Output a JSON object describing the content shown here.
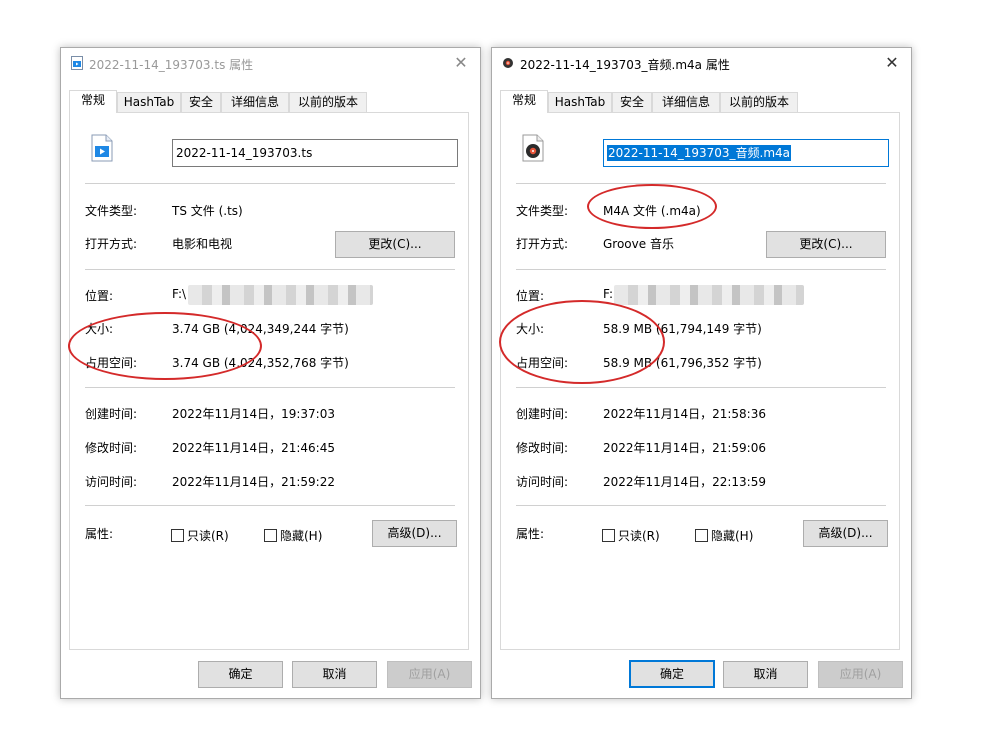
{
  "dialogs": [
    {
      "title": "2022-11-14_193703.ts 属性",
      "tabs": [
        "常规",
        "HashTab",
        "安全",
        "详细信息",
        "以前的版本"
      ],
      "filename": "2022-11-14_193703.ts",
      "type_label": "文件类型:",
      "type_value": "TS 文件 (.ts)",
      "open_label": "打开方式:",
      "open_value": "电影和电视",
      "change_button": "更改(C)...",
      "location_label": "位置:",
      "location_value": "F:\\",
      "size_label": "大小:",
      "size_value": "3.74 GB (4,024,349,244 字节)",
      "disk_label": "占用空间:",
      "disk_value": "3.74 GB (4,024,352,768 字节)",
      "created_label": "创建时间:",
      "created_value": "2022年11月14日，19:37:03",
      "modified_label": "修改时间:",
      "modified_value": "2022年11月14日，21:46:45",
      "accessed_label": "访问时间:",
      "accessed_value": "2022年11月14日，21:59:22",
      "attr_label": "属性:",
      "readonly_label": "只读(R)",
      "hidden_label": "隐藏(H)",
      "advanced_button": "高级(D)...",
      "ok_button": "确定",
      "cancel_button": "取消",
      "apply_button": "应用(A)"
    },
    {
      "title": "2022-11-14_193703_音频.m4a 属性",
      "tabs": [
        "常规",
        "HashTab",
        "安全",
        "详细信息",
        "以前的版本"
      ],
      "filename": "2022-11-14_193703_音频.m4a",
      "type_label": "文件类型:",
      "type_value": "M4A 文件 (.m4a)",
      "open_label": "打开方式:",
      "open_value": "Groove 音乐",
      "change_button": "更改(C)...",
      "location_label": "位置:",
      "location_value": "F:",
      "size_label": "大小:",
      "size_value": "58.9 MB (61,794,149 字节)",
      "disk_label": "占用空间:",
      "disk_value": "58.9 MB (61,796,352 字节)",
      "created_label": "创建时间:",
      "created_value": "2022年11月14日，21:58:36",
      "modified_label": "修改时间:",
      "modified_value": "2022年11月14日，21:59:06",
      "accessed_label": "访问时间:",
      "accessed_value": "2022年11月14日，22:13:59",
      "attr_label": "属性:",
      "readonly_label": "只读(R)",
      "hidden_label": "隐藏(H)",
      "advanced_button": "高级(D)...",
      "ok_button": "确定",
      "cancel_button": "取消",
      "apply_button": "应用(A)"
    }
  ],
  "colors": {
    "annotation_red": "#d42a2a",
    "selection_blue": "#0078d7",
    "button_face": "#e1e1e1"
  },
  "icons": {
    "dialog1": "video-file-icon",
    "dialog2": "audio-file-icon",
    "close": "close-icon"
  }
}
